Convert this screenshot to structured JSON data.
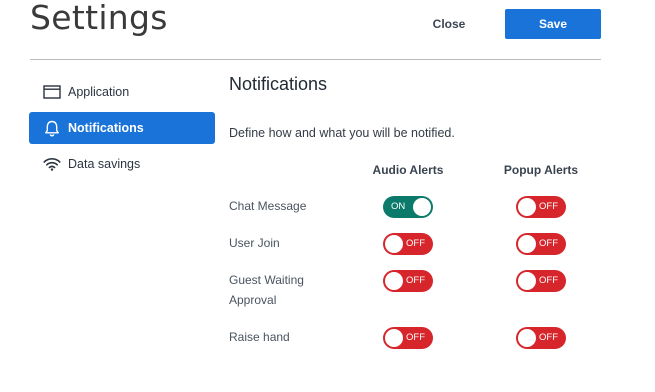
{
  "header": {
    "title": "Settings",
    "close_label": "Close",
    "save_label": "Save"
  },
  "sidebar": {
    "items": [
      {
        "label": "Application",
        "icon": "application-window-icon",
        "active": false
      },
      {
        "label": "Notifications",
        "icon": "bell-icon",
        "active": true
      },
      {
        "label": "Data savings",
        "icon": "wifi-icon",
        "active": false
      }
    ]
  },
  "main": {
    "title": "Notifications",
    "description": "Define how and what you will be notified.",
    "columns": [
      "Audio Alerts",
      "Popup Alerts"
    ],
    "rows": [
      {
        "label": "Chat Message",
        "audio": "ON",
        "popup": "OFF"
      },
      {
        "label": "User Join",
        "audio": "OFF",
        "popup": "OFF"
      },
      {
        "label": "Guest Waiting Approval",
        "audio": "OFF",
        "popup": "OFF"
      },
      {
        "label": "Raise hand",
        "audio": "OFF",
        "popup": "OFF"
      }
    ]
  },
  "colors": {
    "accent": "#1a73d9",
    "toggle_on": "#0b7a6b",
    "toggle_off": "#d7262b"
  }
}
